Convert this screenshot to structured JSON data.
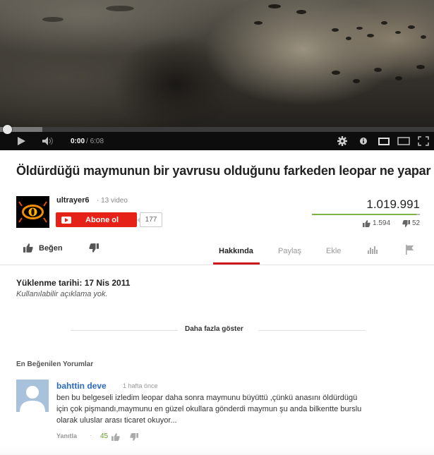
{
  "player": {
    "time_current": "0:00",
    "time_duration": "/ 6:08",
    "progress": 0.0,
    "loaded": 0.098
  },
  "video": {
    "title": "Öldürdüğü maymunun bir yavrusu olduğunu farkeden leopar ne yapar",
    "views": "1.019.991",
    "likes": "1.594",
    "dislikes": "52",
    "like_ratio": 0.968
  },
  "owner": {
    "channel_name": "ultrayer6",
    "video_count": "· 13 video",
    "subscribe_label": "Abone ol",
    "subscriber_count": "177"
  },
  "actions": {
    "like_label": "Beğen",
    "tabs": [
      "Hakkında",
      "Paylaş",
      "Ekle"
    ]
  },
  "description": {
    "upload_date": "Yüklenme tarihi: 17 Nis 2011",
    "no_description": "Kullanılabilir açıklama yok.",
    "show_more": "Daha fazla göster"
  },
  "comments": {
    "heading": "En Beğenilen Yorumlar",
    "items": [
      {
        "author": "bahttin deve",
        "time": "1 hafta önce",
        "lines": [
          "ben bu belgeseli izledim leopar daha sonra maymunu büyüttü ,çünkü anasını öldürdügü",
          "için çok pişmandı,maymunu en güzel okullara gönderdi maymun şu anda bilkentte burslu",
          "olarak uluslar arası ticaret okuyor..."
        ],
        "reply_label": "Yanıtla",
        "separator": "·",
        "likes": "45"
      }
    ]
  },
  "colors": {
    "subscribe_red": "#e62117",
    "link_blue": "#2a6bbf",
    "like_green": "#7cb342",
    "tab_underline": "#cc181e"
  },
  "icons": [
    "play-icon",
    "volume-icon",
    "gear-icon",
    "info-icon",
    "small-player-icon",
    "large-player-icon",
    "fullscreen-icon",
    "thumbs-up-icon",
    "thumbs-down-icon",
    "stats-icon",
    "flag-icon",
    "youtube-play-icon"
  ]
}
